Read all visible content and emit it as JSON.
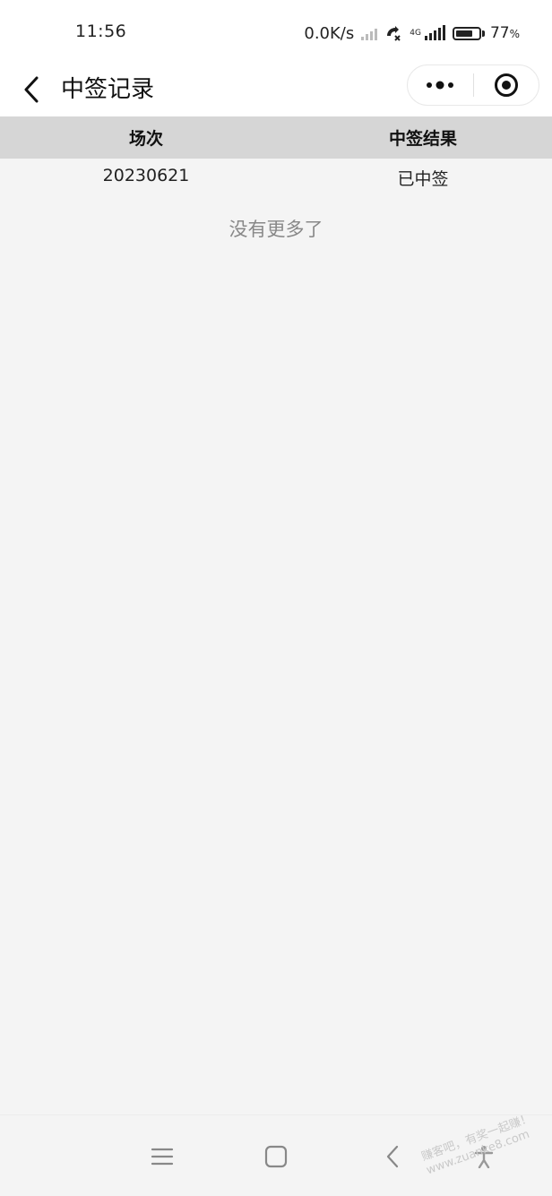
{
  "status_bar": {
    "time": "11:56",
    "network_speed": "0.0K/s",
    "network_type": "4G",
    "battery_percent": "77",
    "battery_unit": "%",
    "battery_level": 0.77,
    "icons": [
      "signal-icon",
      "call-blocked-icon",
      "signal-4g-icon",
      "battery-icon"
    ]
  },
  "nav": {
    "title": "中签记录",
    "back_icon": "chevron-left-icon",
    "more_icon": "more-dots-icon",
    "close_icon": "target-circle-icon"
  },
  "table": {
    "headers": [
      "场次",
      "中签结果"
    ],
    "rows": [
      [
        "20230621",
        "已中签"
      ]
    ]
  },
  "footer_text": "没有更多了",
  "bottom_nav": {
    "icons": [
      "menu-icon",
      "home-square-icon",
      "back-triangle-icon",
      "accessibility-icon"
    ]
  },
  "watermark": {
    "line1": "赚客吧，有奖一起赚！",
    "line2": "www.zuanke8.com"
  }
}
